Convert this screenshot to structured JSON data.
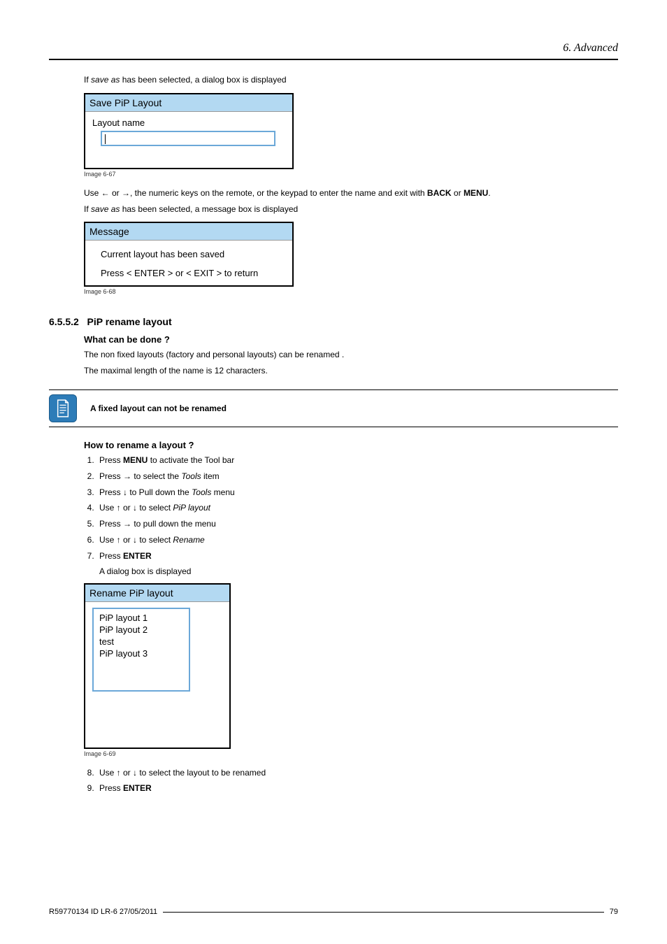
{
  "header": {
    "chapter": "6.  Advanced"
  },
  "intro1": {
    "pre": "If ",
    "em": "save as",
    "post": " has been selected, a dialog box is displayed"
  },
  "dialog1": {
    "title": "Save PiP Layout",
    "label": "Layout name",
    "caption": "Image 6-67"
  },
  "line_arrows": {
    "pre": "Use ← or →, the numeric keys on the remote, or the keypad to enter the name and exit with ",
    "b1": "BACK",
    "mid": " or ",
    "b2": "MENU",
    "post": "."
  },
  "intro2": {
    "pre": "If ",
    "em": "save as",
    "post": " has been selected, a message box is displayed"
  },
  "dialog2": {
    "title": "Message",
    "line1": "Current layout has been saved",
    "line2": "Press < ENTER > or < EXIT > to return",
    "caption": "Image 6-68"
  },
  "section": {
    "num": "6.5.5.2",
    "title": "PiP rename layout"
  },
  "what": {
    "heading": "What can be done ?",
    "p1": "The non fixed layouts (factory and personal layouts) can be renamed .",
    "p2": "The maximal length of the name is 12 characters."
  },
  "note": "A fixed layout can not be renamed",
  "howto": {
    "heading": "How to rename a layout ?",
    "steps": [
      {
        "pre": "Press ",
        "b": "MENU",
        "post": " to activate the Tool bar"
      },
      {
        "pre": "Press → to select the ",
        "em": "Tools",
        "post": " item"
      },
      {
        "pre": "Press ↓ to Pull down the ",
        "em": "Tools",
        "post": " menu"
      },
      {
        "pre": "Use ↑ or ↓ to select ",
        "em": "PiP layout",
        "post": ""
      },
      {
        "pre": "Press → to pull down the menu",
        "em": "",
        "post": ""
      },
      {
        "pre": "Use ↑ or ↓ to select ",
        "em": "Rename",
        "post": ""
      },
      {
        "pre": "Press ",
        "b": "ENTER",
        "post": ""
      }
    ],
    "sub_after_7": "A dialog box is displayed"
  },
  "dialog3": {
    "title": "Rename PiP layout",
    "items": [
      "PiP layout 1",
      "PiP layout 2",
      "test",
      "PiP layout 3"
    ],
    "caption": "Image 6-69"
  },
  "steps_cont": {
    "s8": "Use ↑ or ↓ to select the layout to be renamed",
    "s9_pre": "Press ",
    "s9_b": "ENTER"
  },
  "footer": {
    "left": "R59770134  ID LR-6  27/05/2011",
    "right": "79"
  }
}
